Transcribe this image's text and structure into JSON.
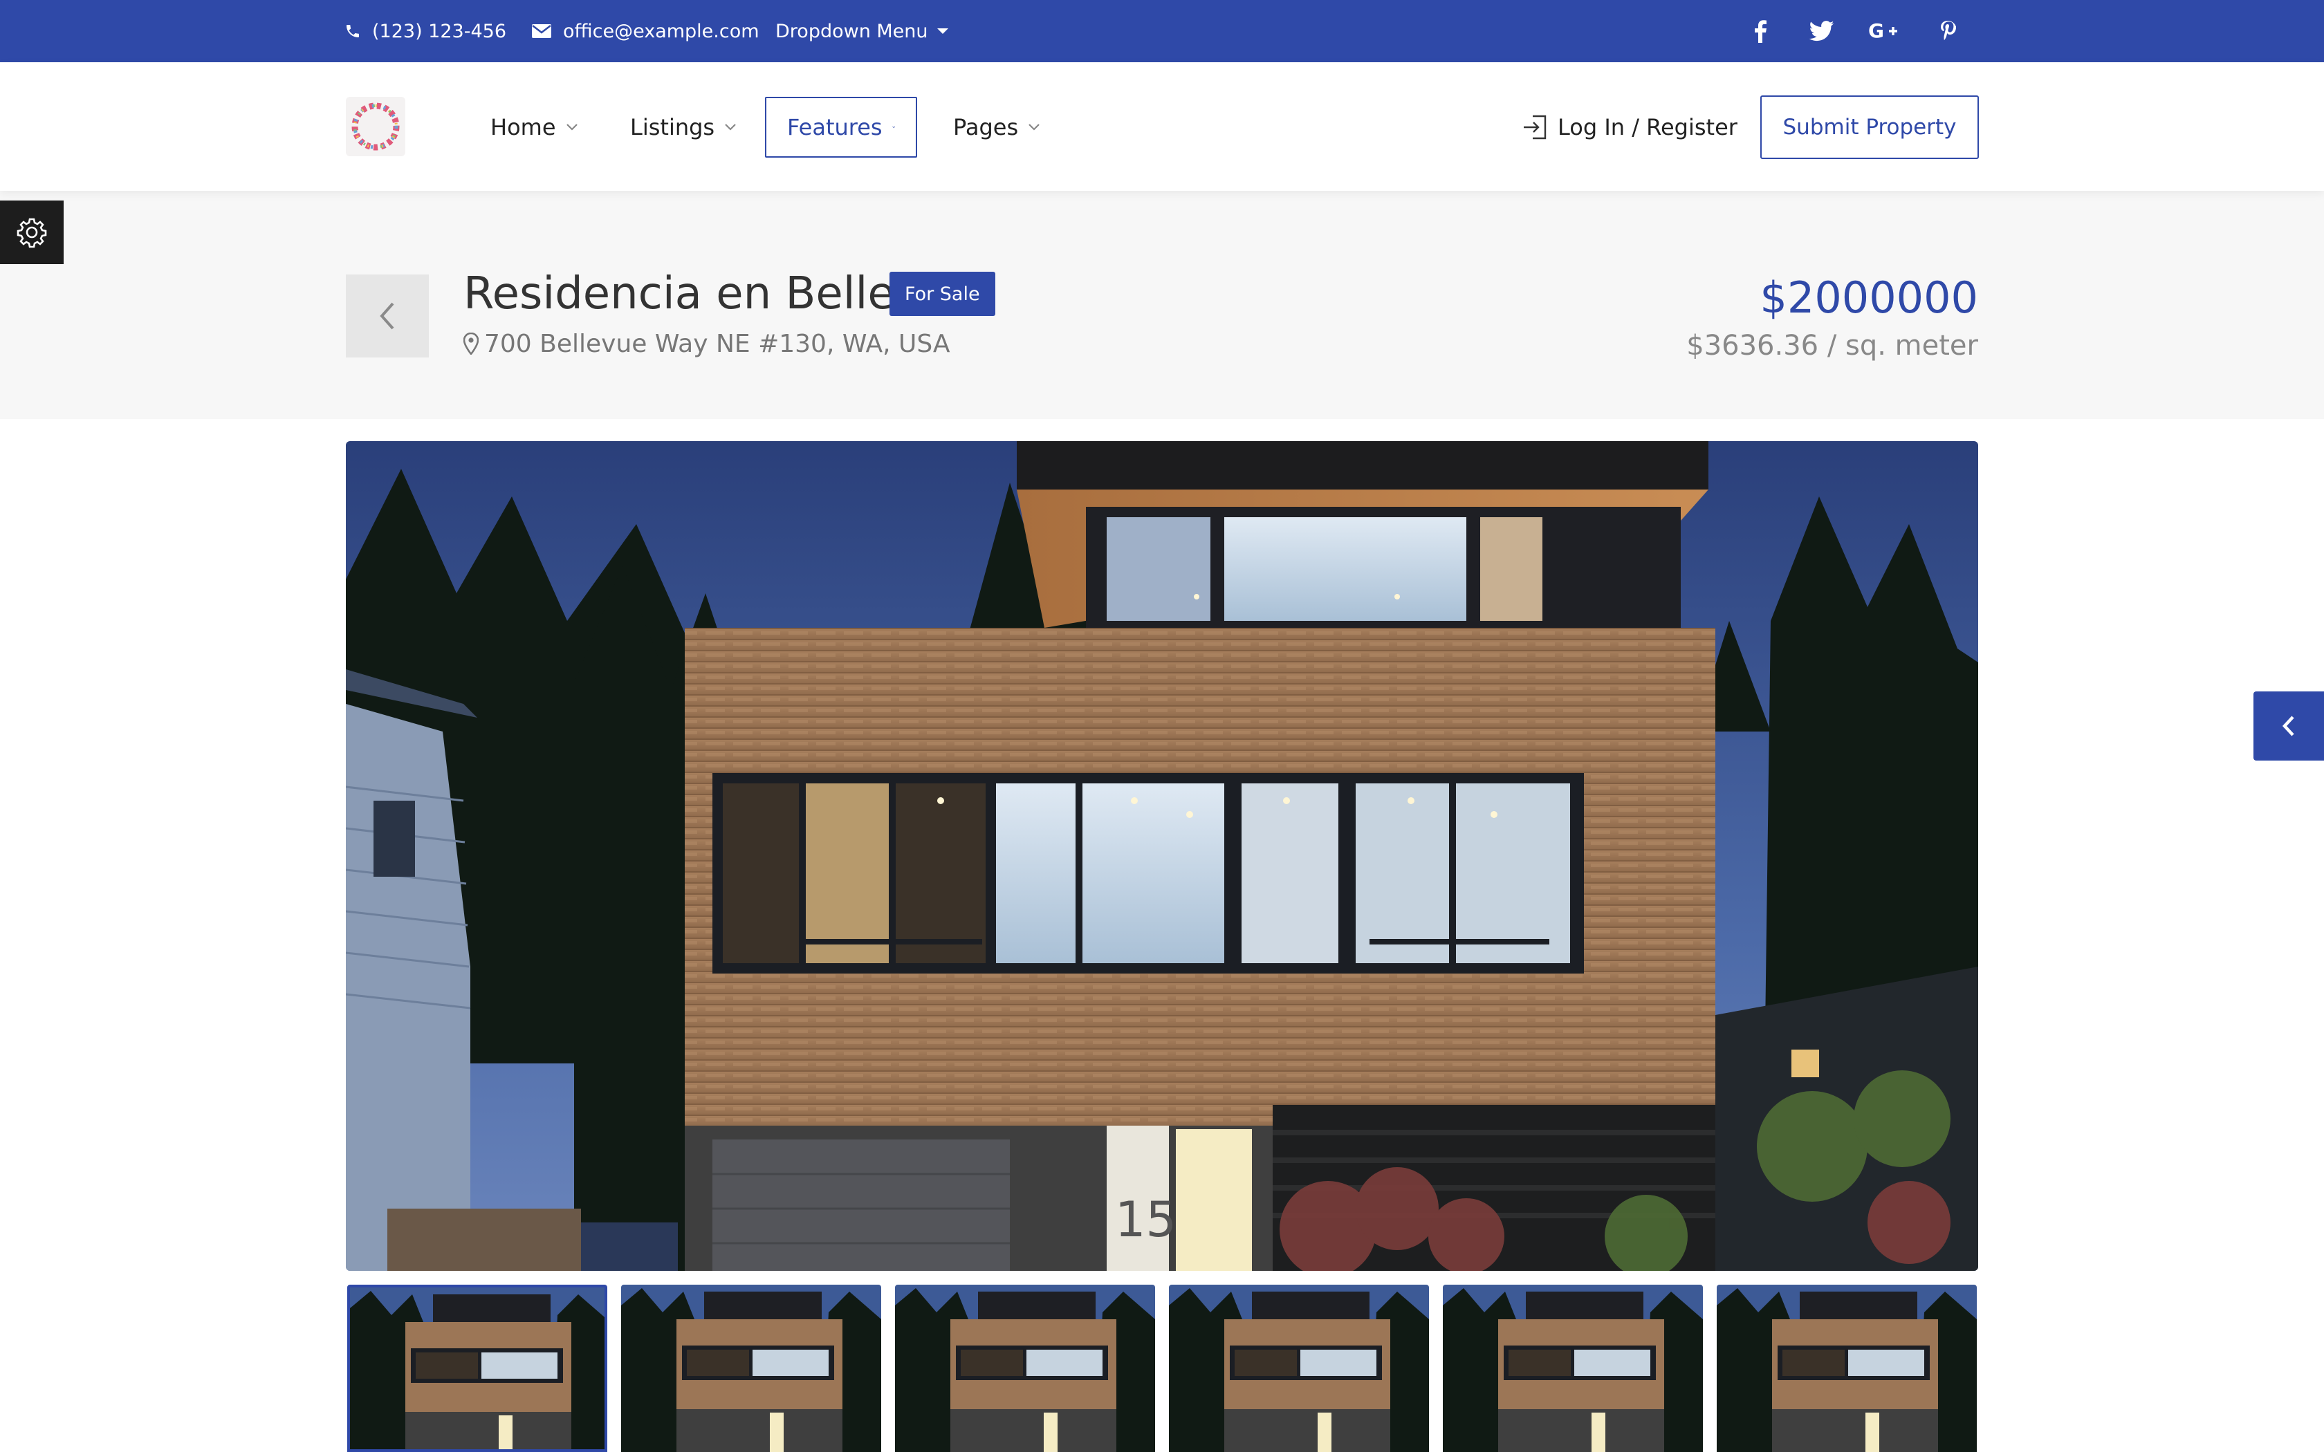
{
  "topbar": {
    "phone": "(123) 123-456",
    "email": "office@example.com",
    "dropdown_label": "Dropdown Menu",
    "social": [
      "facebook-icon",
      "twitter-icon",
      "google-plus-icon",
      "pinterest-icon"
    ]
  },
  "header": {
    "nav": [
      {
        "label": "Home"
      },
      {
        "label": "Listings"
      },
      {
        "label": "Features"
      },
      {
        "label": "Pages"
      }
    ],
    "login_label": "Log In / Register",
    "submit_label": "Submit Property"
  },
  "property": {
    "title": "Residencia en Bellevue",
    "badge": "For Sale",
    "address": "700 Bellevue Way NE #130, WA, USA",
    "price": "$2000000",
    "price_per_sqm": "$3636.36 / sq. meter"
  },
  "gallery": {
    "thumbnail_count": 6,
    "selected_index": 0
  },
  "colors": {
    "accent": "#2f49a8",
    "topbar_bg": "#2f49a8",
    "settings_tab_bg": "#1d1d1d",
    "title_band_bg": "#f7f7f7"
  }
}
